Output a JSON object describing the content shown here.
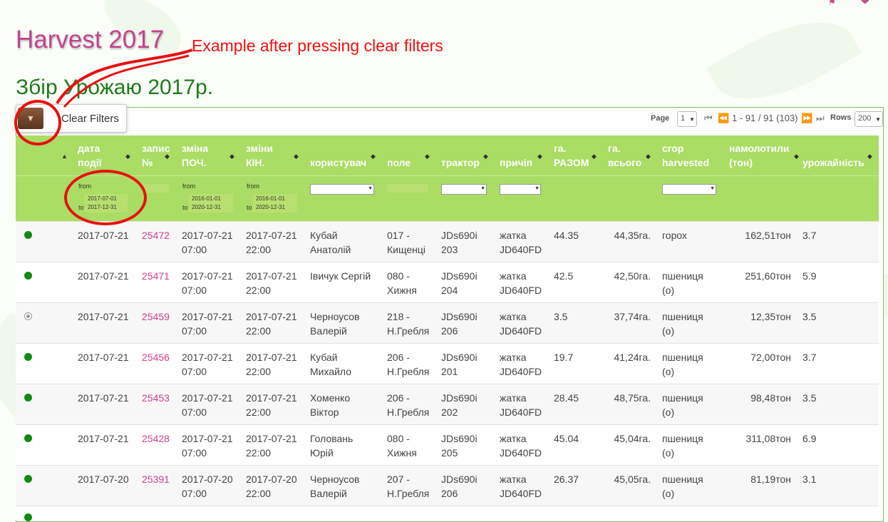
{
  "site_title": "Harvest 2017",
  "annotation": "Example after pressing clear filters",
  "page_heading": "Збір Урожаю 2017р.",
  "toolbar": {
    "clear_filters_label": "Clear Filters"
  },
  "paginator": {
    "page_label": "Page",
    "page_value": "1",
    "range_text": "1 - 91 / 91 (103)",
    "rows_label": "Rows",
    "rows_value": "200"
  },
  "columns": [
    "дата події",
    "запис №",
    "зміна ПОЧ.",
    "зміни КІН.",
    "користувач",
    "поле",
    "трактор",
    "причіп",
    "га. РАЗОМ",
    "га. всього",
    "crop harvested",
    "намолотили (тон)",
    "урожайність"
  ],
  "filters": {
    "date": {
      "from_label": "from",
      "from": "2017-07-01",
      "to_label": "to",
      "to": "2017-12-31"
    },
    "start": {
      "from_label": "from",
      "from": "2016-01-01",
      "to_label": "to",
      "to": "2020-12-31"
    },
    "end": {
      "from_label": "from",
      "from": "2016-01-01",
      "to_label": "to",
      "to": "2020-12-31"
    }
  },
  "rows": [
    {
      "status": "on",
      "date": "2017-07-21",
      "id": "25472",
      "start_date": "2017-07-21",
      "start_time": "07:00",
      "end_date": "2017-07-21",
      "end_time": "22:00",
      "user1": "Кубай",
      "user2": "Анатолій",
      "field1": "017 -",
      "field2": "Кищенці",
      "tractor1": "JDs690i",
      "tractor2": "203",
      "trailer1": "жатка",
      "trailer2": "JD640FD",
      "ha_total": "44.35",
      "ha_all": "44,35га.",
      "crop1": "горох",
      "crop2": "",
      "tons": "162,51тон",
      "yield": "3.7"
    },
    {
      "status": "on",
      "date": "2017-07-21",
      "id": "25471",
      "start_date": "2017-07-21",
      "start_time": "07:00",
      "end_date": "2017-07-21",
      "end_time": "22:00",
      "user1": "Івичук Сергій",
      "user2": "",
      "field1": "080 -",
      "field2": "Хижня",
      "tractor1": "JDs690i",
      "tractor2": "204",
      "trailer1": "жатка",
      "trailer2": "JD640FD",
      "ha_total": "42.5",
      "ha_all": "42,50га.",
      "crop1": "пшениця",
      "crop2": "(о)",
      "tons": "251,60тон",
      "yield": "5.9"
    },
    {
      "status": "off",
      "date": "2017-07-21",
      "id": "25459",
      "start_date": "2017-07-21",
      "start_time": "07:00",
      "end_date": "2017-07-21",
      "end_time": "22:00",
      "user1": "Черноусов",
      "user2": "Валерій",
      "field1": "218 -",
      "field2": "Н.Гребля",
      "tractor1": "JDs690i",
      "tractor2": "206",
      "trailer1": "жатка",
      "trailer2": "JD640FD",
      "ha_total": "3.5",
      "ha_all": "37,74га.",
      "crop1": "пшениця",
      "crop2": "(о)",
      "tons": "12,35тон",
      "yield": "3.5"
    },
    {
      "status": "on",
      "date": "2017-07-21",
      "id": "25456",
      "start_date": "2017-07-21",
      "start_time": "07:00",
      "end_date": "2017-07-21",
      "end_time": "22:00",
      "user1": "Кубай",
      "user2": "Михайло",
      "field1": "206 -",
      "field2": "Н.Гребля",
      "tractor1": "JDs690i",
      "tractor2": "201",
      "trailer1": "жатка",
      "trailer2": "JD640FD",
      "ha_total": "19.7",
      "ha_all": "41,24га.",
      "crop1": "пшениця",
      "crop2": "(о)",
      "tons": "72,00тон",
      "yield": "3.7"
    },
    {
      "status": "on",
      "date": "2017-07-21",
      "id": "25453",
      "start_date": "2017-07-21",
      "start_time": "07:00",
      "end_date": "2017-07-21",
      "end_time": "22:00",
      "user1": "Хоменко",
      "user2": "Віктор",
      "field1": "206 -",
      "field2": "Н.Гребля",
      "tractor1": "JDs690i",
      "tractor2": "202",
      "trailer1": "жатка",
      "trailer2": "JD640FD",
      "ha_total": "28.45",
      "ha_all": "48,75га.",
      "crop1": "пшениця",
      "crop2": "(о)",
      "tons": "98,48тон",
      "yield": "3.5"
    },
    {
      "status": "on",
      "date": "2017-07-21",
      "id": "25428",
      "start_date": "2017-07-21",
      "start_time": "07:00",
      "end_date": "2017-07-21",
      "end_time": "22:00",
      "user1": "Головань",
      "user2": "Юрій",
      "field1": "080 -",
      "field2": "Хижня",
      "tractor1": "JDs690i",
      "tractor2": "205",
      "trailer1": "жатка",
      "trailer2": "JD640FD",
      "ha_total": "45.04",
      "ha_all": "45,04га.",
      "crop1": "пшениця",
      "crop2": "(о)",
      "tons": "311,08тон",
      "yield": "6.9"
    },
    {
      "status": "on",
      "date": "2017-07-20",
      "id": "25391",
      "start_date": "2017-07-20",
      "start_time": "07:00",
      "end_date": "2017-07-20",
      "end_time": "22:00",
      "user1": "Черноусов",
      "user2": "Валерій",
      "field1": "207 -",
      "field2": "Н.Гребля",
      "tractor1": "JDs690i",
      "tractor2": "206",
      "trailer1": "жатка",
      "trailer2": "JD640FD",
      "ha_total": "26.37",
      "ha_all": "45,05га.",
      "crop1": "пшениця",
      "crop2": "(о)",
      "tons": "81,19тон",
      "yield": "3.1"
    }
  ]
}
